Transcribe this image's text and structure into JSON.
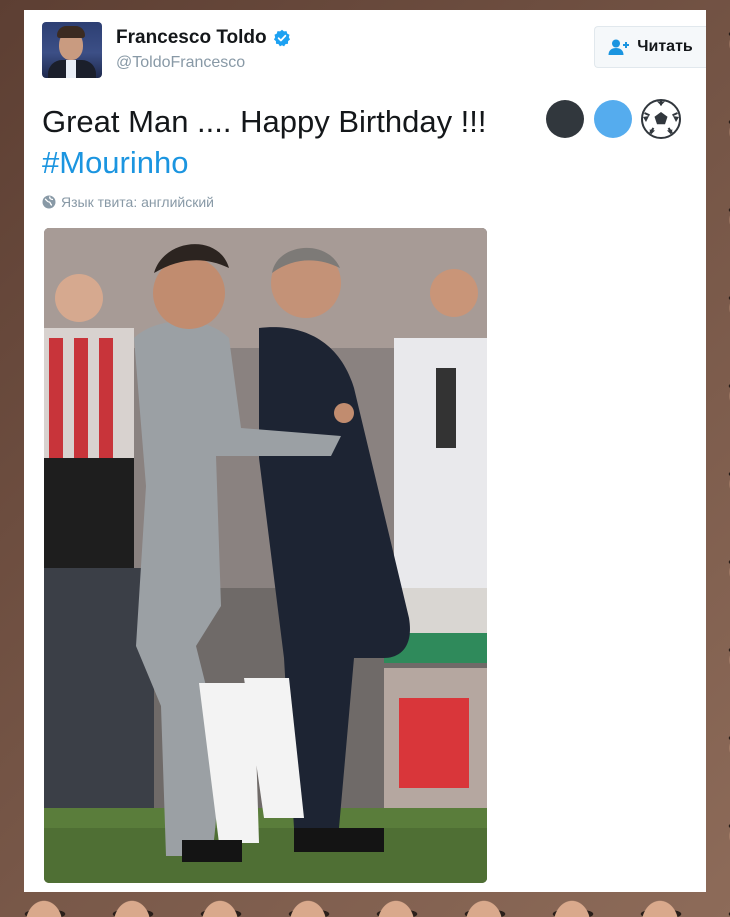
{
  "tweet": {
    "author_name": "Francesco Toldo",
    "handle": "@ToldoFrancesco",
    "verified": true,
    "follow_label": "Читать",
    "text": "Great Man .... Happy Birthday !!!",
    "hashtag": "#Mourinho",
    "emojis": [
      "black-circle",
      "blue-circle",
      "soccer-ball"
    ],
    "language_note": "Язык твита: английский"
  },
  "colors": {
    "link_blue": "#1b95e0",
    "verified_blue": "#1da1f2",
    "muted_text": "#8899a6",
    "follow_bg": "#f5f8fa"
  },
  "icons": {
    "verified": "verified-badge-icon",
    "follow": "person-plus-icon",
    "language": "globe-icon"
  }
}
